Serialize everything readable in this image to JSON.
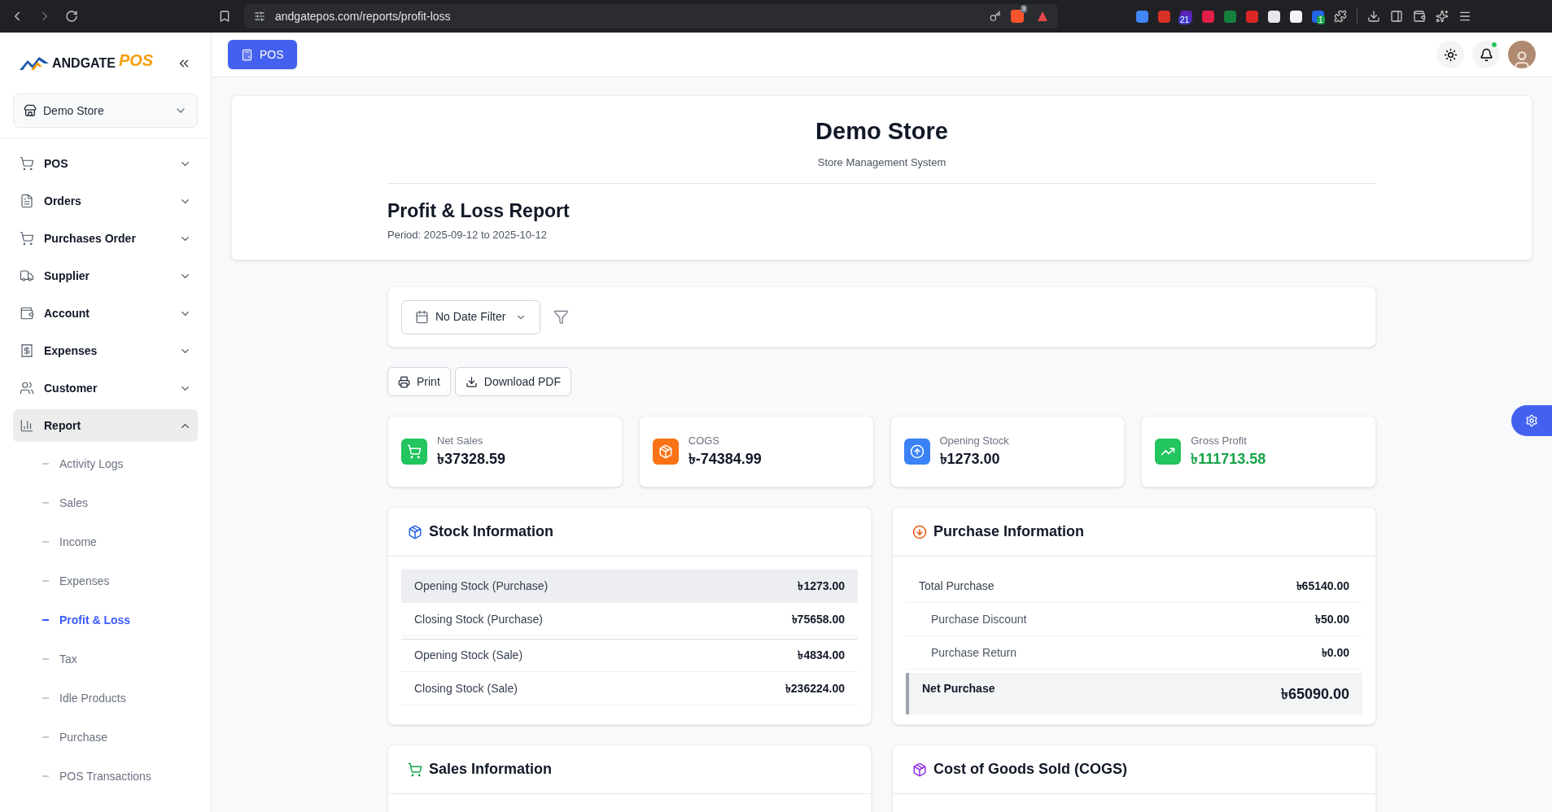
{
  "browser": {
    "url": "andgatepos.com/reports/profit-loss",
    "badges": [
      "3",
      "21",
      "1"
    ]
  },
  "sidebar": {
    "logo": {
      "word": "ANDGATE",
      "accent": "POS"
    },
    "store_select": "Demo Store",
    "items": [
      {
        "label": "POS",
        "kind": "cart",
        "expanded": false
      },
      {
        "label": "Orders",
        "kind": "doc",
        "expanded": false
      },
      {
        "label": "Purchases Order",
        "kind": "cart",
        "expanded": false
      },
      {
        "label": "Supplier",
        "kind": "truck",
        "expanded": false
      },
      {
        "label": "Account",
        "kind": "wallet",
        "expanded": false
      },
      {
        "label": "Expenses",
        "kind": "receipt",
        "expanded": false
      },
      {
        "label": "Customer",
        "kind": "users",
        "expanded": false
      },
      {
        "label": "Report",
        "kind": "chart",
        "expanded": true,
        "children": [
          {
            "label": "Activity Logs",
            "selected": false
          },
          {
            "label": "Sales",
            "selected": false
          },
          {
            "label": "Income",
            "selected": false
          },
          {
            "label": "Expenses",
            "selected": false
          },
          {
            "label": "Profit & Loss",
            "selected": true
          },
          {
            "label": "Tax",
            "selected": false
          },
          {
            "label": "Idle Products",
            "selected": false
          },
          {
            "label": "Purchase",
            "selected": false
          },
          {
            "label": "POS Transactions",
            "selected": false
          }
        ]
      }
    ]
  },
  "topbar": {
    "pos_button": "POS",
    "notification_dot": true
  },
  "header": {
    "store": "Demo Store",
    "subtitle": "Store Management System",
    "title": "Profit & Loss Report",
    "period": "Period: 2025-09-12 to 2025-10-12"
  },
  "filter": {
    "date_filter": "No Date Filter"
  },
  "actions": [
    {
      "label": "Print",
      "kind": "print"
    },
    {
      "label": "Download PDF",
      "kind": "download"
    }
  ],
  "stats": [
    {
      "label": "Net Sales",
      "value": "৳37328.59",
      "kind": "sales"
    },
    {
      "label": "COGS",
      "value": "৳-74384.99",
      "kind": "cogs"
    },
    {
      "label": "Opening Stock",
      "value": "৳1273.00",
      "kind": "stock"
    },
    {
      "label": "Gross Profit",
      "value": "৳111713.58",
      "kind": "profit"
    }
  ],
  "stock_information": {
    "title": "Stock Information",
    "rows": [
      {
        "label": "Opening Stock (Purchase)",
        "value": "৳1273.00",
        "highlighted": true
      },
      {
        "label": "Closing Stock (Purchase)",
        "value": "৳75658.00",
        "highlighted": false
      },
      {
        "label": "Opening Stock (Sale)",
        "value": "৳4834.00",
        "highlighted": false
      },
      {
        "label": "Closing Stock (Sale)",
        "value": "৳236224.00",
        "highlighted": false
      }
    ]
  },
  "purchase_information": {
    "title": "Purchase Information",
    "rows": [
      {
        "label": "Total Purchase",
        "value": "৳65140.00",
        "kind": "total"
      },
      {
        "label": "Purchase Discount",
        "value": "৳50.00",
        "kind": "sub"
      },
      {
        "label": "Purchase Return",
        "value": "৳0.00",
        "kind": "sub"
      },
      {
        "label": "Net Purchase",
        "value": "৳65090.00",
        "kind": "net"
      }
    ]
  },
  "sales_information": {
    "title": "Sales Information"
  },
  "cogs_information": {
    "title": "Cost of Goods Sold (COGS)"
  }
}
